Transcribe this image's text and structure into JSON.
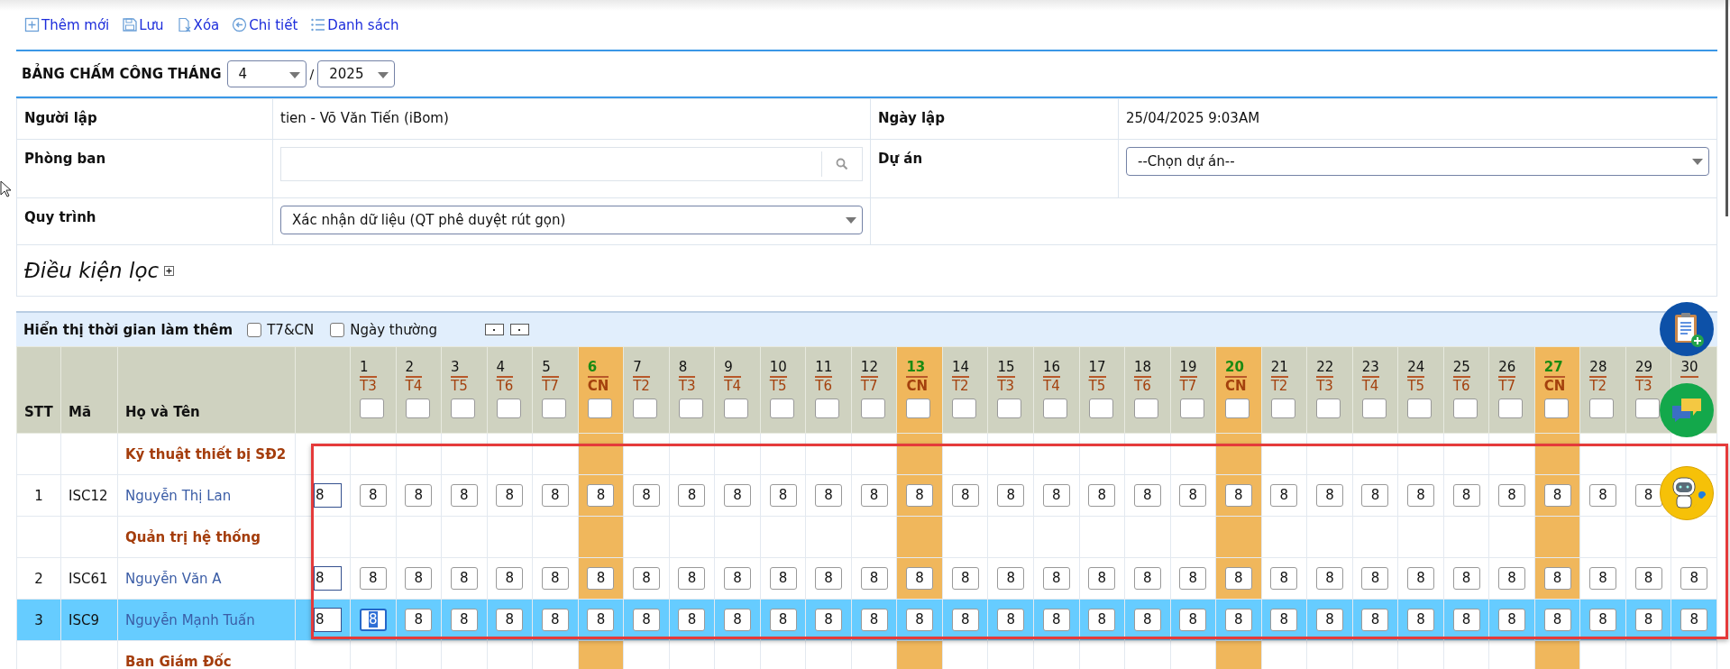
{
  "toolbar": [
    {
      "label": "Thêm mới"
    },
    {
      "label": "Lưu"
    },
    {
      "label": "Xóa"
    },
    {
      "label": "Chi tiết"
    },
    {
      "label": "Danh sách"
    }
  ],
  "heading": {
    "title": "BẢNG CHẤM CÔNG THÁNG",
    "month": "4",
    "separator": "/",
    "year": "2025"
  },
  "form": {
    "creator_label": "Người lập",
    "creator": "tien - Võ Văn Tiến (iBom)",
    "date_label": "Ngày lập",
    "date": "25/04/2025 9:03AM",
    "department_label": "Phòng ban",
    "project_label": "Dự án",
    "project": "--Chọn dự án--",
    "process_label": "Quy trình",
    "process": "Xác nhận dữ liệu (QT phê duyệt rút gọn)"
  },
  "filter": {
    "title": "Điều kiện lọc",
    "expanded": false
  },
  "overtime": {
    "label": "Hiển thị thời gian làm thêm",
    "options": [
      {
        "label": "T7&CN",
        "checked": false
      },
      {
        "label": "Ngày thường",
        "checked": false
      }
    ]
  },
  "table": {
    "columns": [
      "STT",
      "Mã",
      "Họ và Tên"
    ],
    "days": [
      {
        "day": "1",
        "weekday": "T3",
        "weekend": false
      },
      {
        "day": "2",
        "weekday": "T4",
        "weekend": false
      },
      {
        "day": "3",
        "weekday": "T5",
        "weekend": false
      },
      {
        "day": "4",
        "weekday": "T6",
        "weekend": false
      },
      {
        "day": "5",
        "weekday": "T7",
        "weekend": false
      },
      {
        "day": "6",
        "weekday": "CN",
        "weekend": true
      },
      {
        "day": "7",
        "weekday": "T2",
        "weekend": false
      },
      {
        "day": "8",
        "weekday": "T3",
        "weekend": false
      },
      {
        "day": "9",
        "weekday": "T4",
        "weekend": false
      },
      {
        "day": "10",
        "weekday": "T5",
        "weekend": false
      },
      {
        "day": "11",
        "weekday": "T6",
        "weekend": false
      },
      {
        "day": "12",
        "weekday": "T7",
        "weekend": false
      },
      {
        "day": "13",
        "weekday": "CN",
        "weekend": true
      },
      {
        "day": "14",
        "weekday": "T2",
        "weekend": false
      },
      {
        "day": "15",
        "weekday": "T3",
        "weekend": false
      },
      {
        "day": "16",
        "weekday": "T4",
        "weekend": false
      },
      {
        "day": "17",
        "weekday": "T5",
        "weekend": false
      },
      {
        "day": "18",
        "weekday": "T6",
        "weekend": false
      },
      {
        "day": "19",
        "weekday": "T7",
        "weekend": false
      },
      {
        "day": "20",
        "weekday": "CN",
        "weekend": true
      },
      {
        "day": "21",
        "weekday": "T2",
        "weekend": false
      },
      {
        "day": "22",
        "weekday": "T3",
        "weekend": false
      },
      {
        "day": "23",
        "weekday": "T4",
        "weekend": false
      },
      {
        "day": "24",
        "weekday": "T5",
        "weekend": false
      },
      {
        "day": "25",
        "weekday": "T6",
        "weekend": false
      },
      {
        "day": "26",
        "weekday": "T7",
        "weekend": false
      },
      {
        "day": "27",
        "weekday": "CN",
        "weekend": true
      },
      {
        "day": "28",
        "weekday": "T2",
        "weekend": false
      },
      {
        "day": "29",
        "weekday": "T3",
        "weekend": false
      },
      {
        "day": "30",
        "weekend": false
      }
    ],
    "rows": [
      {
        "kind": "group",
        "name": "Kỹ thuật thiết bị SĐ2"
      },
      {
        "kind": "employee",
        "stt": "1",
        "code": "ISC12",
        "name": "Nguyễn Thị Lan",
        "total": "8",
        "selected": false,
        "editing_first_day": false,
        "days": [
          "8",
          "8",
          "8",
          "8",
          "8",
          "8",
          "8",
          "8",
          "8",
          "8",
          "8",
          "8",
          "8",
          "8",
          "8",
          "8",
          "8",
          "8",
          "8",
          "8",
          "8",
          "8",
          "8",
          "8",
          "8",
          "8",
          "8",
          "8",
          "8"
        ]
      },
      {
        "kind": "group",
        "name": "Quản trị hệ thống"
      },
      {
        "kind": "employee",
        "stt": "2",
        "code": "ISC61",
        "name": "Nguyễn Văn A",
        "total": "8",
        "selected": false,
        "editing_first_day": false,
        "days": [
          "8",
          "8",
          "8",
          "8",
          "8",
          "8",
          "8",
          "8",
          "8",
          "8",
          "8",
          "8",
          "8",
          "8",
          "8",
          "8",
          "8",
          "8",
          "8",
          "8",
          "8",
          "8",
          "8",
          "8",
          "8",
          "8",
          "8",
          "8",
          "8",
          "8"
        ]
      },
      {
        "kind": "employee",
        "stt": "3",
        "code": "ISC9",
        "name": "Nguyễn Mạnh Tuấn",
        "total": "8",
        "selected": true,
        "editing_first_day": true,
        "days": [
          "8",
          "8",
          "8",
          "8",
          "8",
          "8",
          "8",
          "8",
          "8",
          "8",
          "8",
          "8",
          "8",
          "8",
          "8",
          "8",
          "8",
          "8",
          "8",
          "8",
          "8",
          "8",
          "8",
          "8",
          "8",
          "8",
          "8",
          "8",
          "8",
          "8"
        ]
      },
      {
        "kind": "group",
        "name": "Ban Giám Đốc"
      }
    ]
  }
}
